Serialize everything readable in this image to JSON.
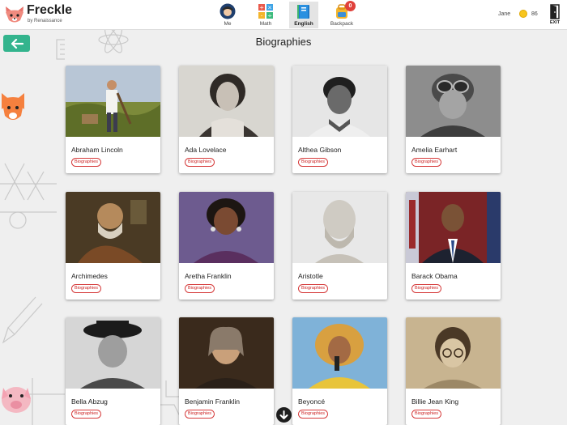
{
  "header": {
    "logo_text": "Freckle",
    "logo_sub": "by Renaissance",
    "nav": [
      {
        "label": "Me",
        "icon": "avatar-icon"
      },
      {
        "label": "Math",
        "icon": "math-grid-icon"
      },
      {
        "label": "English",
        "icon": "book-icon"
      },
      {
        "label": "Backpack",
        "icon": "backpack-icon"
      }
    ],
    "backpack_badge": "0",
    "user_name": "Jane",
    "coins": "86",
    "exit_label": "EXIT"
  },
  "page": {
    "title": "Biographies"
  },
  "cards": [
    {
      "name": "Abraham Lincoln",
      "tag": "Biographies"
    },
    {
      "name": "Ada Lovelace",
      "tag": "Biographies"
    },
    {
      "name": "Althea Gibson",
      "tag": "Biographies"
    },
    {
      "name": "Amelia Earhart",
      "tag": "Biographies"
    },
    {
      "name": "Archimedes",
      "tag": "Biographies"
    },
    {
      "name": "Aretha Franklin",
      "tag": "Biographies"
    },
    {
      "name": "Aristotle",
      "tag": "Biographies"
    },
    {
      "name": "Barack Obama",
      "tag": "Biographies"
    },
    {
      "name": "Bella Abzug",
      "tag": "Biographies"
    },
    {
      "name": "Benjamin Franklin",
      "tag": "Biographies"
    },
    {
      "name": "Beyoncé",
      "tag": "Biographies"
    },
    {
      "name": "Billie Jean King",
      "tag": "Biographies"
    }
  ],
  "colors": {
    "accent": "#33b48d",
    "tag_red": "#d63b3b",
    "badge_red": "#e0413b"
  }
}
